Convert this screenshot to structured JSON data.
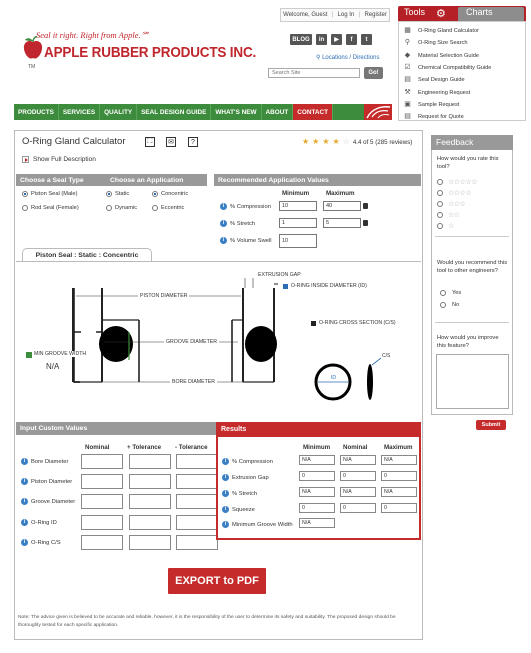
{
  "header": {
    "welcome": "Welcome, Guest",
    "login": "Log In",
    "register": "Register",
    "tagline": "Seal it right. Right from Apple.℠",
    "company": "APPLE RUBBER PRODUCTS INC.",
    "tm": "TM",
    "social": [
      "BLOG",
      "in",
      "▶",
      "f",
      "t"
    ],
    "locations": "Locations / Directions",
    "search_placeholder": "Search Site",
    "go_label": "Go!"
  },
  "tools": {
    "tab_label": "Tools",
    "charts_label": "Charts",
    "items": [
      "O-Ring Gland Calculator",
      "O-Ring Size Search",
      "Material Selection Guide",
      "Chemical Compatibility Guide",
      "Seal Design Guide",
      "Engineering Request",
      "Sample Request",
      "Request for Quote"
    ]
  },
  "nav": {
    "items": [
      "PRODUCTS",
      "SERVICES",
      "QUALITY",
      "SEAL DESIGN GUIDE",
      "WHAT'S NEW",
      "ABOUT",
      "CONTACT"
    ],
    "active": "CONTACT"
  },
  "calculator": {
    "title": "O-Ring Gland Calculator",
    "title_icons": [
      "⛶",
      "✉",
      "?"
    ],
    "rating": {
      "stars": 4,
      "text": "4.4 of 5 (285 reviews)"
    },
    "show_description": "Show Full Description",
    "seal_type": {
      "header": "Choose a Seal Type",
      "options": [
        "Piston Seal (Male)",
        "Rod Seal (Female)"
      ],
      "selected": "Piston Seal (Male)"
    },
    "application": {
      "header": "Choose an Application",
      "options": [
        "Static",
        "Concentric",
        "Dynamic",
        "Eccentric"
      ],
      "selected": [
        "Static",
        "Concentric"
      ]
    },
    "recommended": {
      "header": "Recommended Application Values",
      "col_min": "Minimum",
      "col_max": "Maximum",
      "rows": [
        {
          "label": "% Compression",
          "min": "10",
          "max": "40"
        },
        {
          "label": "% Stretch",
          "min": "1",
          "max": "5"
        },
        {
          "label": "% Volume Swell",
          "min": "10",
          "max": ""
        }
      ]
    },
    "diagram": {
      "tab_label": "Piston Seal : Static : Concentric",
      "extrusion_gap": "EXTRUSION GAP",
      "piston_diameter": "PISTON DIAMETER",
      "groove_diameter": "GROOVE DIAMETER",
      "bore_diameter": "BORE DIAMETER",
      "min_groove_width": "MIN GROOVE WIDTH",
      "min_groove_value": "N/A",
      "legend_id": "O-RING INSIDE DIAMETER (ID)",
      "legend_cs": "O-RING CROSS SECTION (C/S)",
      "id_label": "ID",
      "cs_label": "C/S"
    },
    "custom": {
      "header": "Input Custom Values",
      "columns": [
        "Nominal",
        "+ Tolerance",
        "- Tolerance"
      ],
      "rows": [
        "Bore Diameter",
        "Piston Diameter",
        "Groove Diameter",
        "O-Ring ID",
        "O-Ring C/S"
      ]
    },
    "results": {
      "header": "Results",
      "columns": [
        "Minimum",
        "Nominal",
        "Maximum"
      ],
      "rows": [
        {
          "label": "% Compression",
          "values": [
            "N/A",
            "N/A",
            "N/A"
          ]
        },
        {
          "label": "Extrusion Gap",
          "values": [
            "0",
            "0",
            "0"
          ]
        },
        {
          "label": "% Stretch",
          "values": [
            "N/A",
            "N/A",
            "N/A"
          ]
        },
        {
          "label": "Squeeze",
          "values": [
            "0",
            "0",
            "0"
          ]
        },
        {
          "label": "Minimum Groove Width",
          "values": [
            "N/A"
          ]
        }
      ]
    },
    "export_label": "EXPORT to PDF",
    "note": "Note: The advice given is believed to be accurate and reliable, however, it is the responsibility of the user to determine its safety and suitability. The proposed design should be thoroughly tested for each specific application."
  },
  "feedback": {
    "header": "Feedback",
    "q1": "How would you rate this tool?",
    "q2": "Would you recommend this tool to other engineers?",
    "yes": "Yes",
    "no": "No",
    "q3": "How would you improve this feature?",
    "submit": "Submit"
  },
  "colors": {
    "red": "#c62b2b",
    "green": "#3d8b3d",
    "blue": "#2a6db5",
    "gray_bar": "#999999"
  }
}
